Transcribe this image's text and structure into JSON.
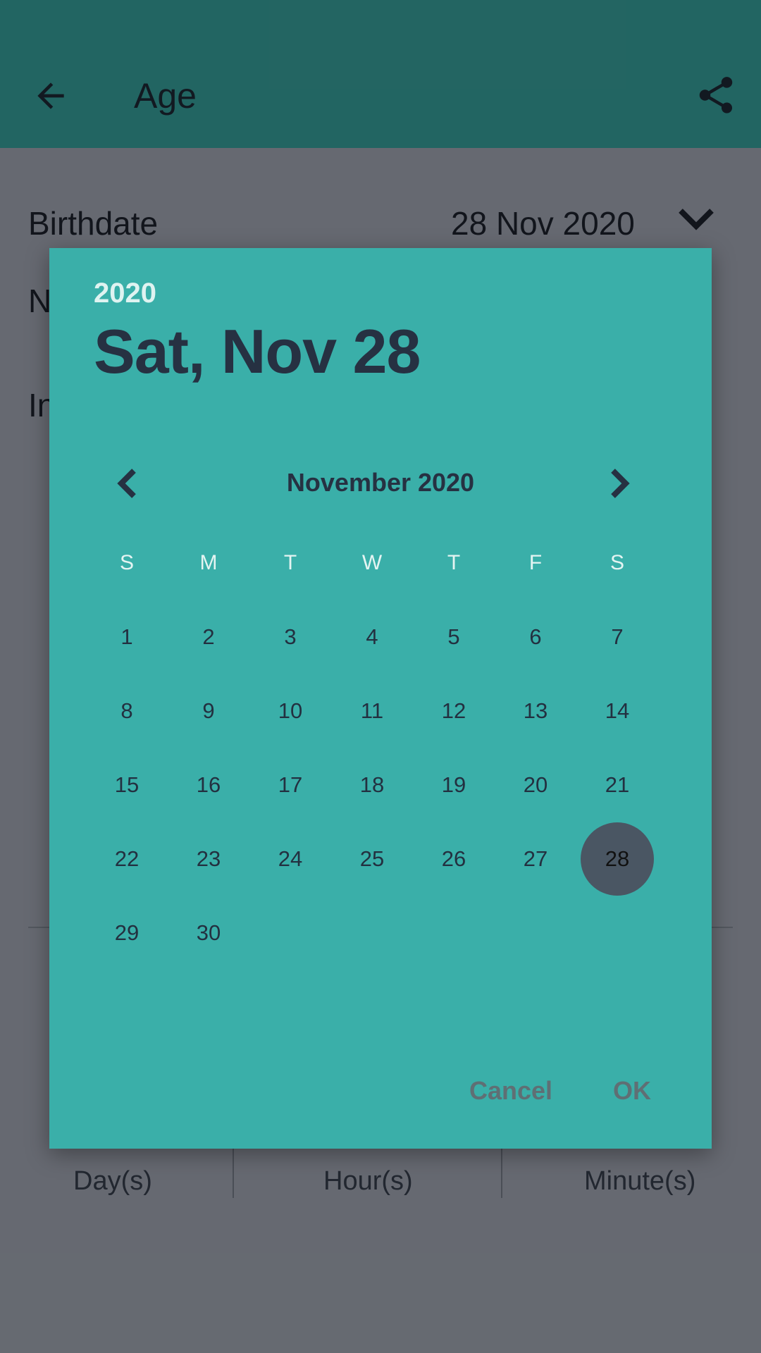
{
  "appbar": {
    "title": "Age"
  },
  "rows": {
    "birthdate_label": "Birthdate",
    "birthdate_value": "28 Nov 2020",
    "row2_partial": "N",
    "row3_partial": "In"
  },
  "units": [
    "Day(s)",
    "Hour(s)",
    "Minute(s)"
  ],
  "dialog": {
    "year": "2020",
    "date": "Sat, Nov 28",
    "month": "November 2020",
    "weekdays": [
      "S",
      "M",
      "T",
      "W",
      "T",
      "F",
      "S"
    ],
    "days": [
      "1",
      "2",
      "3",
      "4",
      "5",
      "6",
      "7",
      "8",
      "9",
      "10",
      "11",
      "12",
      "13",
      "14",
      "15",
      "16",
      "17",
      "18",
      "19",
      "20",
      "21",
      "22",
      "23",
      "24",
      "25",
      "26",
      "27",
      "28",
      "29",
      "30"
    ],
    "selected_day": "28",
    "cancel": "Cancel",
    "ok": "OK"
  },
  "colors": {
    "appbar": "#3aa8a4",
    "dialog": "#3aafa9",
    "selected": "#4a5663"
  }
}
